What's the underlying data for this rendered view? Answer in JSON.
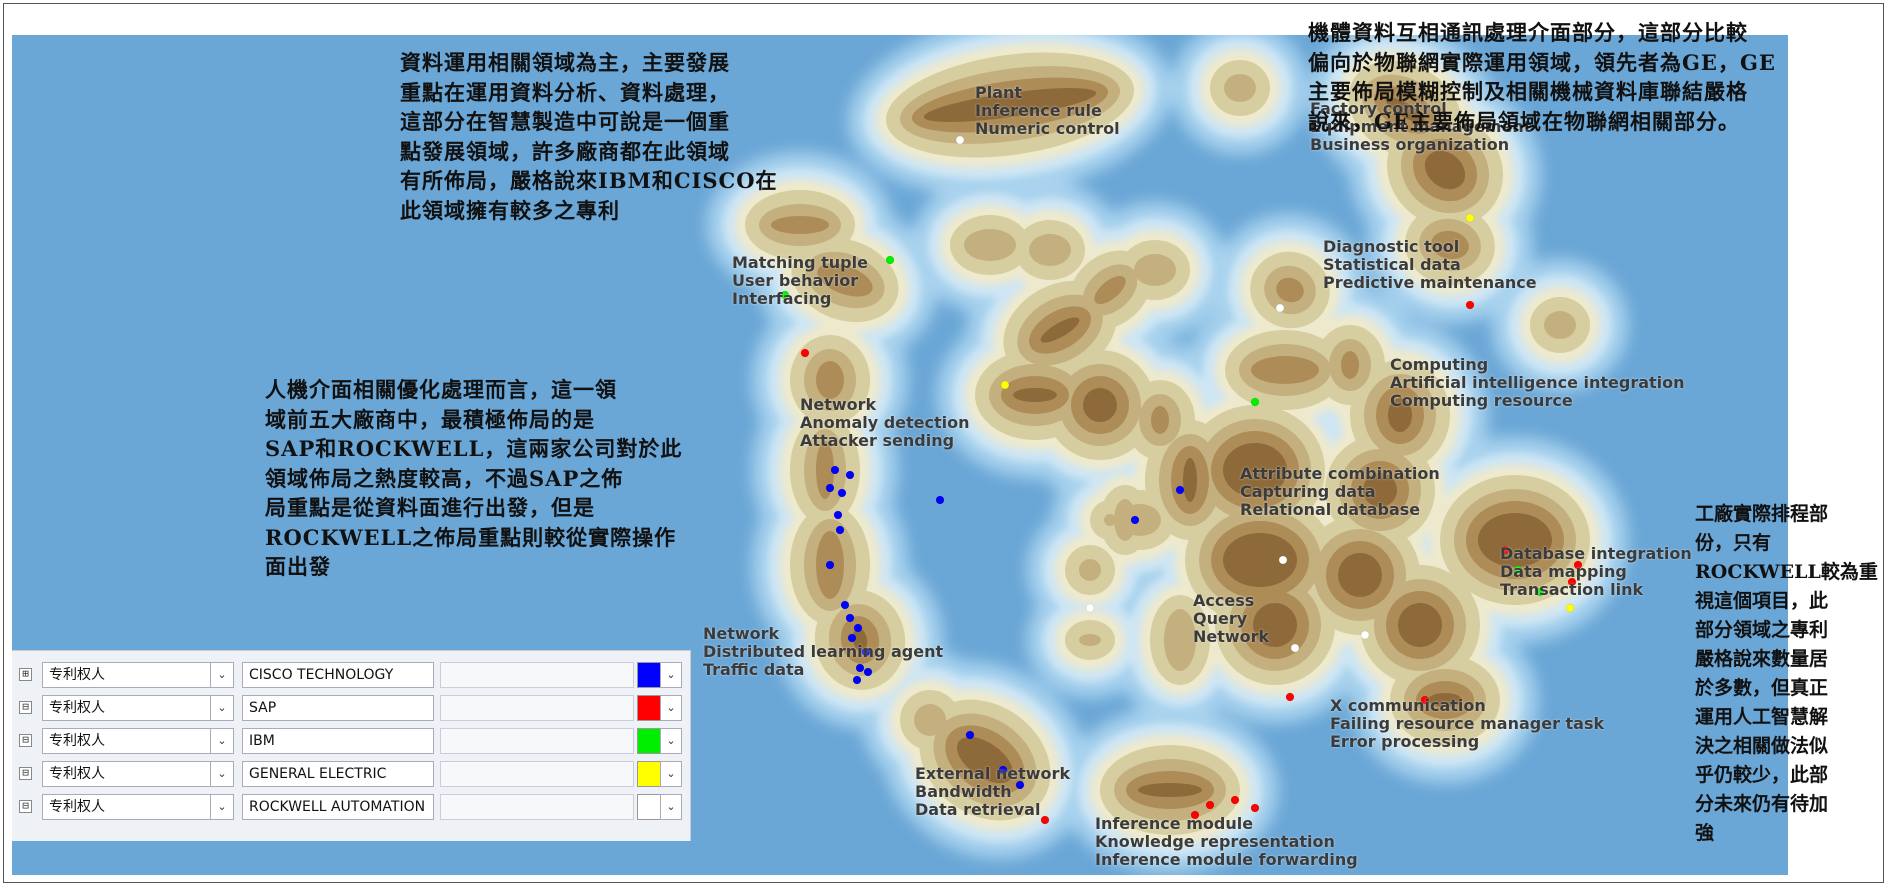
{
  "annotations": {
    "top_left": "資料運用相關領域為主，主要發展\n重點在運用資料分析、資料處理，\n這部分在智慧製造中可說是一個重\n點發展領域，許多廠商都在此領域\n有所佈局，嚴格說來IBM和CISCO在\n此領域擁有較多之專利",
    "mid_left": "人機介面相關優化處理而言，這一領\n域前五大廠商中，最積極佈局的是\nSAP和ROCKWELL，這兩家公司對於此\n領域佈局之熱度較高，不過SAP之佈\n局重點是從資料面進行出發，但是\nROCKWELL之佈局重點則較從實際操作\n面出發",
    "top_right": "機體資料互相通訊處理介面部分，這部分比較\n偏向於物聯網實際運用領域，領先者為GE，GE\n主要佈局模糊控制及相關機械資料庫聯結嚴格\n說來，GE主要佈局領域在物聯網相關部分。",
    "right": "工廠實際排程部\n份，只有\nROCKWELL較為重\n視這個項目，此\n部分領域之專利\n嚴格說來數量居\n於多數，但真正\n運用人工智慧解\n決之相關做法似\n乎仍較少，此部\n分未來仍有待加\n強"
  },
  "map_labels": [
    {
      "id": "plant",
      "lines": [
        "Plant",
        "Inference rule",
        "Numeric control"
      ]
    },
    {
      "id": "business",
      "lines": [
        "Factory control",
        "Equipment management",
        "Business organization"
      ]
    },
    {
      "id": "matching",
      "lines": [
        "Matching tuple",
        "User behavior",
        "Interfacing"
      ]
    },
    {
      "id": "diagnostic",
      "lines": [
        "Diagnostic tool",
        "Statistical data",
        "Predictive maintenance"
      ]
    },
    {
      "id": "computing",
      "lines": [
        "Computing",
        "Artificial intelligence integration",
        "Computing resource"
      ]
    },
    {
      "id": "network_anomaly",
      "lines": [
        "Network",
        "Anomaly detection",
        "Attacker sending"
      ]
    },
    {
      "id": "attribute",
      "lines": [
        "Attribute combination",
        "Capturing data",
        "Relational database"
      ]
    },
    {
      "id": "database",
      "lines": [
        "Database integration",
        "Data mapping",
        "Transaction link"
      ]
    },
    {
      "id": "access",
      "lines": [
        "Access",
        "Query",
        "Network"
      ]
    },
    {
      "id": "network_dist",
      "lines": [
        "Network",
        "Distributed learning agent",
        "Traffic data"
      ]
    },
    {
      "id": "xcomm",
      "lines": [
        "X communication",
        "Failing resource manager task",
        "Error processing"
      ]
    },
    {
      "id": "external",
      "lines": [
        "External network",
        "Bandwidth",
        "Data retrieval"
      ]
    },
    {
      "id": "inference",
      "lines": [
        "Inference module",
        "Knowledge representation",
        "Inference module forwarding"
      ]
    }
  ],
  "legend_rows": [
    {
      "field": "专利权人",
      "value": "CISCO TECHNOLOGY",
      "color": "#0000ff"
    },
    {
      "field": "专利权人",
      "value": "SAP",
      "color": "#ff0000"
    },
    {
      "field": "专利权人",
      "value": "IBM",
      "color": "#00ee00"
    },
    {
      "field": "专利权人",
      "value": "GENERAL ELECTRIC",
      "color": "#ffff00"
    },
    {
      "field": "专利权人",
      "value": "ROCKWELL AUTOMATION",
      "color": "#ffffff"
    }
  ],
  "legend_expanders": [
    "⊞",
    "⊟",
    "⊟",
    "⊟",
    "⊟"
  ],
  "colors": {
    "ocean": "#6aa6d6",
    "shallow": "#a9d3ee",
    "land": "#d9d3a6",
    "peak": "#9a7040"
  }
}
